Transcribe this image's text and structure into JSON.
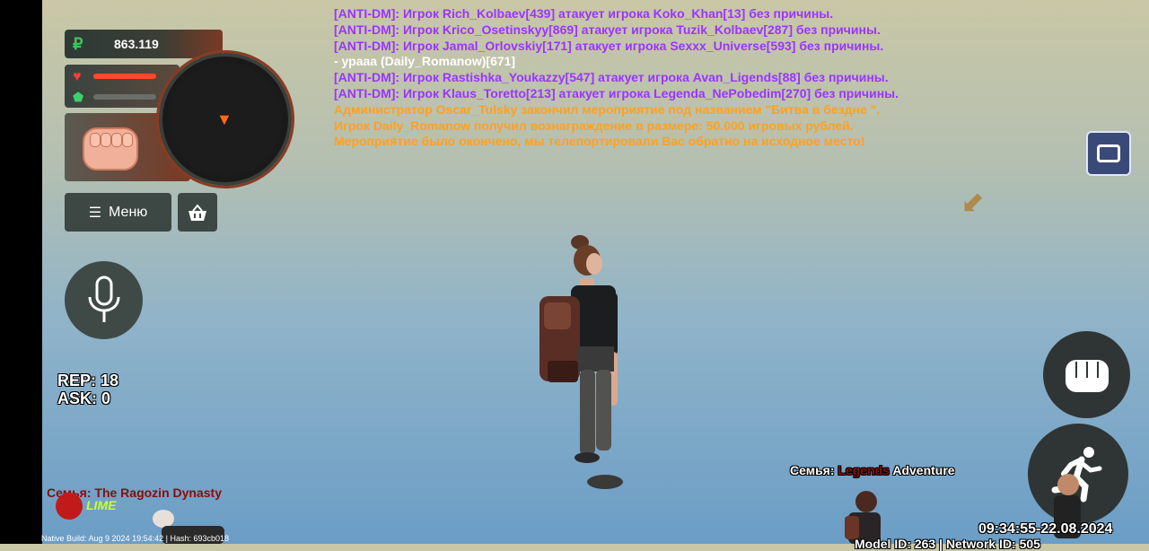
{
  "hud": {
    "currency_symbol": "₽",
    "money": "863.119",
    "health_fraction": 1.0,
    "armor_fraction": 1.0
  },
  "buttons": {
    "menu_label": "Меню"
  },
  "stats": {
    "rep": "REP: 18",
    "ask": "ASK: 0"
  },
  "chat": [
    {
      "text": "[ANTI-DM]: Игрок Rich_Kolbaev[439] атакует игрока Koko_Khan[13] без причины.",
      "color": "purple"
    },
    {
      "text": "[ANTI-DM]: Игрок Krico_Osetinskyy[869] атакует игрока Tuzik_Kolbaev[287] без причины.",
      "color": "purple"
    },
    {
      "text": "[ANTI-DM]: Игрок Jamal_Orlovskiy[171] атакует игрока Sexxx_Universe[593] без причины.",
      "color": "purple"
    },
    {
      "text": "- ураaa (Daily_Romanow)[671]",
      "color": "white"
    },
    {
      "text": "[ANTI-DM]: Игрок Rastishka_Youkazzy[547] атакует игрока Avan_Ligends[88] без причины.",
      "color": "purple"
    },
    {
      "text": "[ANTI-DM]: Игрок Klaus_Toretto[213] атакует игрока Legenda_NePobedim[270] без причины.",
      "color": "purple"
    },
    {
      "text": "Администратор Oscar_Tulsky закончил мероприятие под названием \"Битва в бездне \".",
      "color": "orange"
    },
    {
      "text": "Игрок Daily_Romanow получил вознаграждение в размере: 50.000 игровых рублей.",
      "color": "orange"
    },
    {
      "text": "Мероприятие было окончено, мы телепортировали Вас обратно на исходное место!",
      "color": "orange"
    }
  ],
  "family": {
    "label": "Семья:",
    "name_red": "Legends",
    "name_white": "Adventure"
  },
  "clan": "Семья: The Ragozin Dynasty",
  "brand": "LIME",
  "build_info": "Native Build: Aug  9 2024 19:54:42 | Hash: 693cb018",
  "datetime": "09:34:55-22.08.2024",
  "model_info": "Model ID: 263 | Network ID: 505",
  "colors": {
    "purple": "#9b35ff",
    "white": "#ffffff",
    "orange": "#ffa020",
    "family_red": "#8b0c0c"
  }
}
